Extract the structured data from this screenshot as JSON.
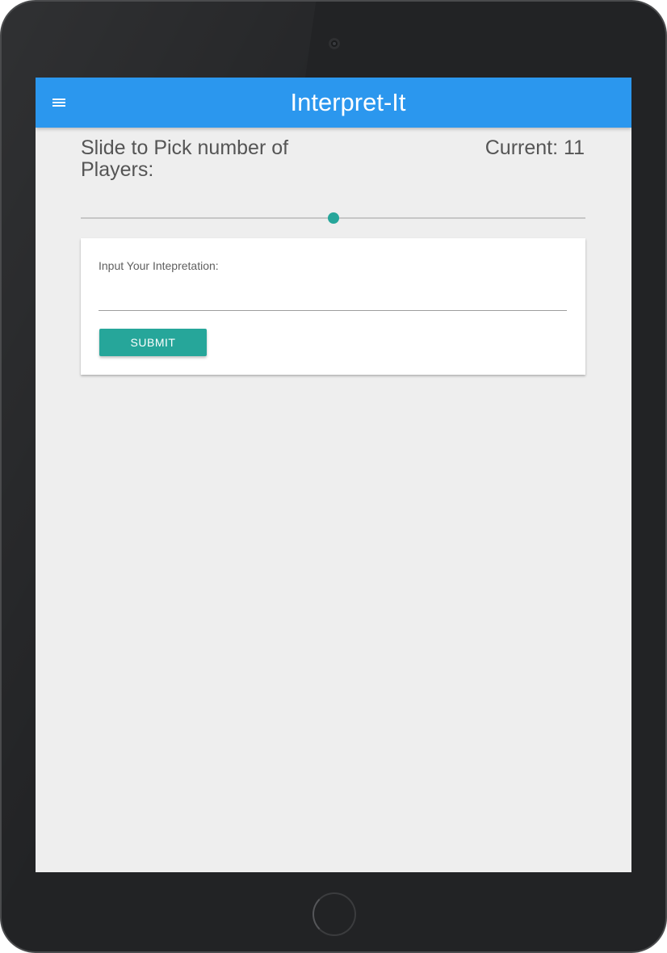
{
  "app": {
    "title": "Interpret-It",
    "header_color": "#2b97ee",
    "accent_color": "#26a69a",
    "menu_icon": "hamburger-menu-icon"
  },
  "players": {
    "label": "Slide to Pick number of Players:",
    "current_label": "Current:",
    "current_value": "11",
    "slider_fraction": 0.5
  },
  "interpretation": {
    "label": "Input Your Intepretation:",
    "value": "",
    "submit_label": "SUBMIT"
  }
}
